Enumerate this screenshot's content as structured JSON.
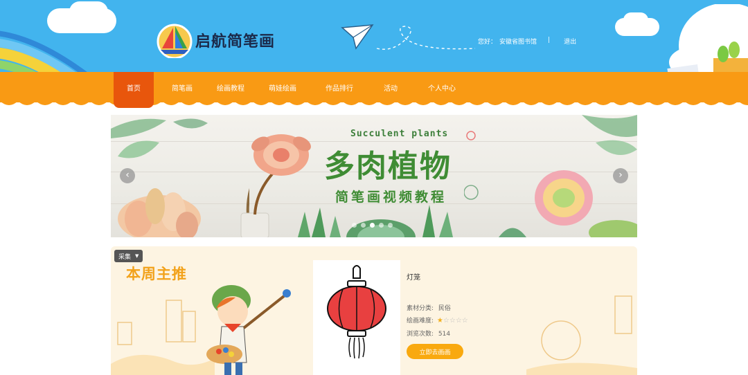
{
  "header": {
    "site_name": "启航简笔画",
    "greeting": "您好：",
    "user_name": "安徽省图书馆",
    "separator": "|",
    "logout": "退出"
  },
  "nav": {
    "items": [
      {
        "label": "首页",
        "active": true
      },
      {
        "label": "简笔画",
        "active": false
      },
      {
        "label": "绘画教程",
        "active": false
      },
      {
        "label": "萌娃绘画",
        "active": false
      },
      {
        "label": "作品排行",
        "active": false
      },
      {
        "label": "活动",
        "active": false
      },
      {
        "label": "个人中心",
        "active": false
      }
    ]
  },
  "banner": {
    "title_en": "Succulent plants",
    "title": "多肉植物",
    "subtitle": "简笔画视频教程",
    "prev_icon": "chevron-left-icon",
    "next_icon": "chevron-right-icon",
    "slide_count": 5,
    "active_slide": 3
  },
  "featured": {
    "collect_label": "采集",
    "section_title": "本周主推",
    "work": {
      "title": "灯笼",
      "category_label": "素材分类:",
      "category_value": "民俗",
      "difficulty_label": "绘画难度:",
      "difficulty_stars": 1,
      "difficulty_max": 5,
      "views_label": "浏览次数:",
      "views_value": "514",
      "action_label": "立即去画画"
    }
  },
  "colors": {
    "sky": "#42b4ee",
    "nav_orange": "#f99a14",
    "nav_active": "#e8560c",
    "banner_green": "#3f8c34",
    "button_yellow": "#f9a90f",
    "section_title": "#f2a21b"
  }
}
